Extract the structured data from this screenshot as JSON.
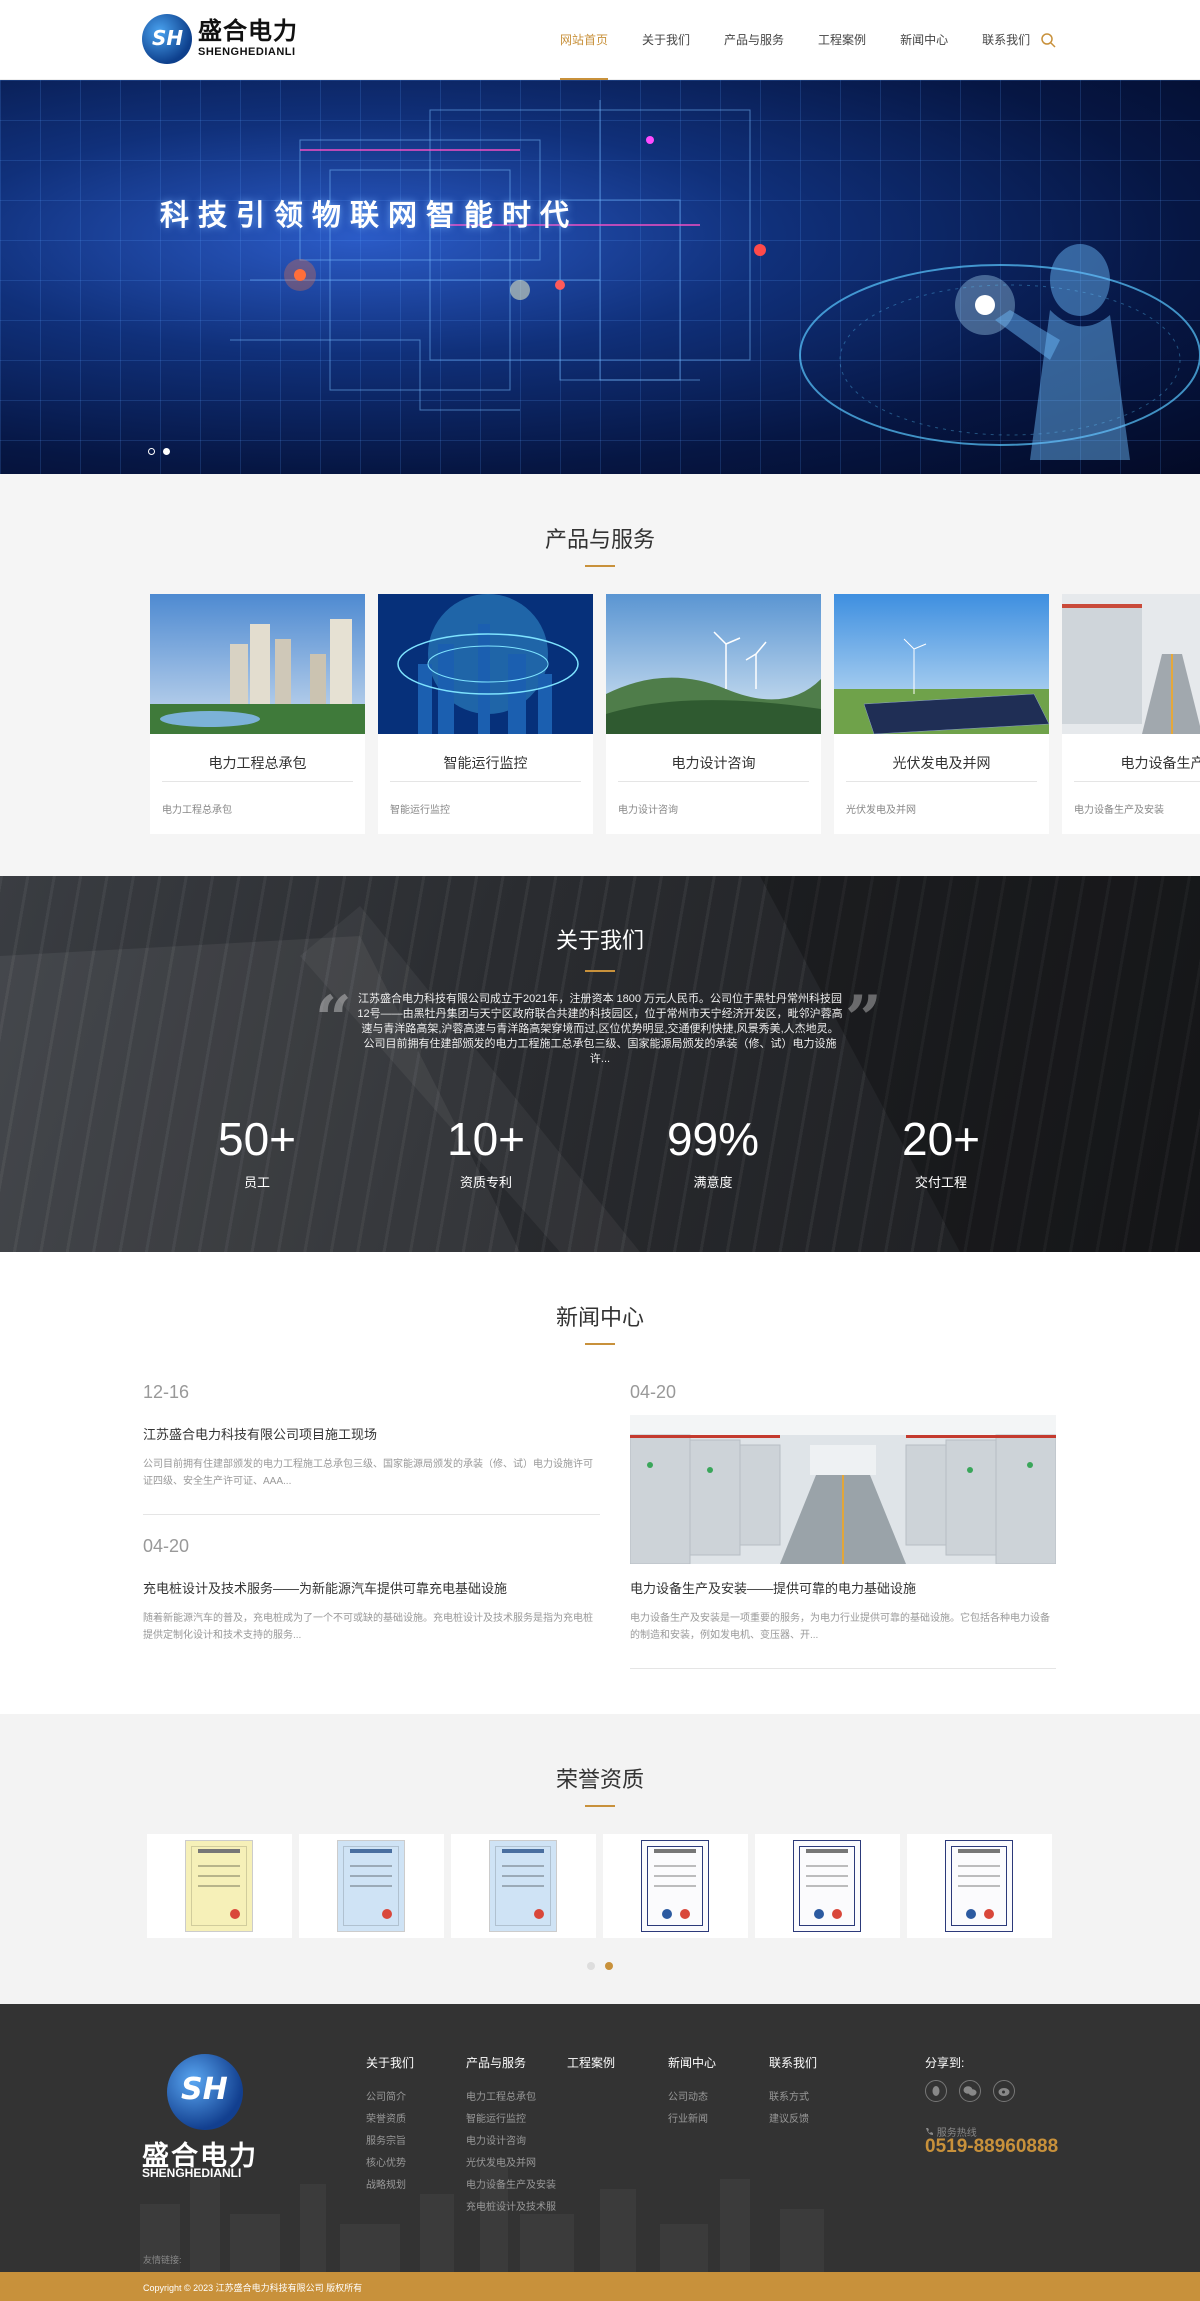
{
  "header": {
    "logo_cn": "盛合电力",
    "logo_en": "SHENGHEDIANLI",
    "nav": [
      "网站首页",
      "关于我们",
      "产品与服务",
      "工程案例",
      "新闻中心",
      "联系我们"
    ]
  },
  "banner": {
    "title": "科技引领物联网智能时代"
  },
  "products": {
    "title": "产品与服务",
    "items": [
      {
        "name": "电力工程总承包",
        "desc": "电力工程总承包"
      },
      {
        "name": "智能运行监控",
        "desc": "智能运行监控"
      },
      {
        "name": "电力设计咨询",
        "desc": "电力设计咨询"
      },
      {
        "name": "光伏发电及并网",
        "desc": "光伏发电及并网"
      },
      {
        "name": "电力设备生产及",
        "desc": "电力设备生产及安装"
      }
    ]
  },
  "about": {
    "title": "关于我们",
    "text": "江苏盛合电力科技有限公司成立于2021年，注册资本 1800 万元人民币。公司位于黑牡丹常州科技园12号——由黑牡丹集团与天宁区政府联合共建的科技园区，位于常州市天宁经济开发区，毗邻沪蓉高速与青洋路高架,沪蓉高速与青洋路高架穿境而过,区位优势明显,交通便利快捷,风景秀美,人杰地灵。 公司目前拥有住建部颁发的电力工程施工总承包三级、国家能源局颁发的承装（修、试）电力设施许...",
    "stats": [
      {
        "num": "50+",
        "label": "员工"
      },
      {
        "num": "10+",
        "label": "资质专利"
      },
      {
        "num": "99%",
        "label": "满意度"
      },
      {
        "num": "20+",
        "label": "交付工程"
      }
    ]
  },
  "news": {
    "title": "新闻中心",
    "left": [
      {
        "date": "12-16",
        "title": "江苏盛合电力科技有限公司项目施工现场",
        "desc": "公司目前拥有住建部颁发的电力工程施工总承包三级、国家能源局颁发的承装（修、试）电力设施许可证四级、安全生产许可证、AAA..."
      },
      {
        "date": "04-20",
        "title": "充电桩设计及技术服务——为新能源汽车提供可靠充电基础设施",
        "desc": "随着新能源汽车的普及，充电桩成为了一个不可或缺的基础设施。充电桩设计及技术服务是指为充电桩提供定制化设计和技术支持的服务..."
      }
    ],
    "right": {
      "date": "04-20",
      "title": "电力设备生产及安装——提供可靠的电力基础设施",
      "desc": "电力设备生产及安装是一项重要的服务，为电力行业提供可靠的基础设施。它包括各种电力设备的制造和安装，例如发电机、变压器、开..."
    }
  },
  "honors": {
    "title": "荣誉资质"
  },
  "footer": {
    "logo_cn": "盛合电力",
    "logo_en": "SHENGHEDIANLI",
    "columns": [
      {
        "title": "关于我们",
        "links": [
          "公司简介",
          "荣誉资质",
          "服务宗旨",
          "核心优势",
          "战略规划"
        ]
      },
      {
        "title": "产品与服务",
        "links": [
          "电力工程总承包",
          "智能运行监控",
          "电力设计咨询",
          "光伏发电及并网",
          "电力设备生产及安装",
          "充电桩设计及技术服"
        ]
      },
      {
        "title": "工程案例",
        "links": []
      },
      {
        "title": "新闻中心",
        "links": [
          "公司动态",
          "行业新闻"
        ]
      },
      {
        "title": "联系我们",
        "links": [
          "联系方式",
          "建议反馈"
        ]
      }
    ],
    "share_title": "分享到:",
    "hotline_label": "服务热线",
    "hotline": "0519-88960888",
    "friend_links": "友情链接:",
    "copyright": "Copyright © 2023 江苏盛合电力科技有限公司 版权所有"
  },
  "colors": {
    "accent": "#c8913b",
    "footer_bg": "#333333"
  }
}
